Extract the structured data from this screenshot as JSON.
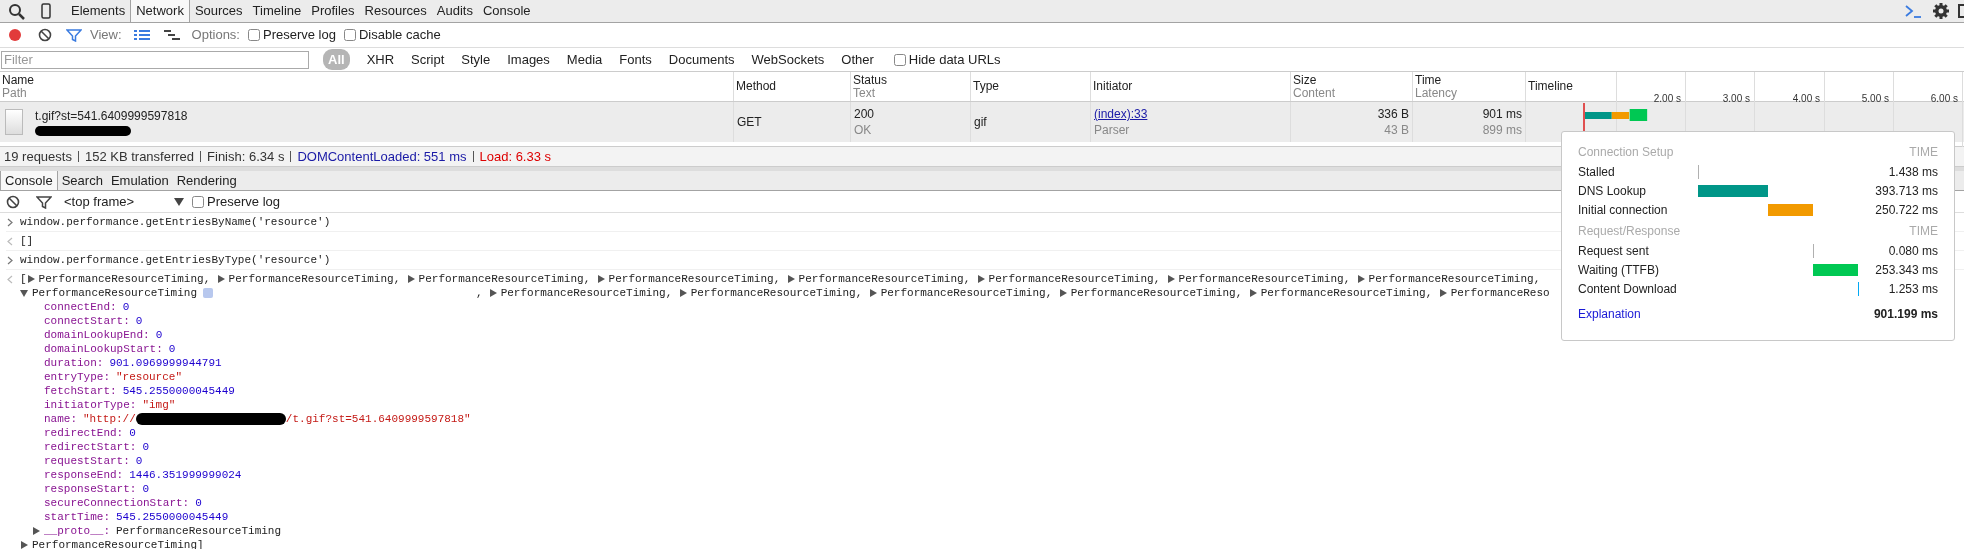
{
  "main_tabs": [
    {
      "label": "Elements",
      "selected": false
    },
    {
      "label": "Network",
      "selected": true
    },
    {
      "label": "Sources",
      "selected": false
    },
    {
      "label": "Timeline",
      "selected": false
    },
    {
      "label": "Profiles",
      "selected": false
    },
    {
      "label": "Resources",
      "selected": false
    },
    {
      "label": "Audits",
      "selected": false
    },
    {
      "label": "Console",
      "selected": false
    }
  ],
  "network_toolbar": {
    "recording": true,
    "view_label": "View:",
    "options_label": "Options:",
    "checkboxes": [
      {
        "label": "Preserve log",
        "checked": false
      },
      {
        "label": "Disable cache",
        "checked": false
      }
    ]
  },
  "filter_bar": {
    "placeholder": "Filter",
    "types": [
      {
        "label": "All",
        "selected": true
      },
      {
        "label": "XHR",
        "selected": false
      },
      {
        "label": "Script",
        "selected": false
      },
      {
        "label": "Style",
        "selected": false
      },
      {
        "label": "Images",
        "selected": false
      },
      {
        "label": "Media",
        "selected": false
      },
      {
        "label": "Fonts",
        "selected": false
      },
      {
        "label": "Documents",
        "selected": false
      },
      {
        "label": "WebSockets",
        "selected": false
      },
      {
        "label": "Other",
        "selected": false
      }
    ],
    "hide_data_urls": {
      "label": "Hide data URLs",
      "checked": false
    }
  },
  "table": {
    "columns": [
      {
        "label": "Name",
        "sublabel": "Path"
      },
      {
        "label": "Method"
      },
      {
        "label": "Status",
        "sublabel": "Text"
      },
      {
        "label": "Type"
      },
      {
        "label": "Initiator"
      },
      {
        "label": "Size",
        "sublabel": "Content"
      },
      {
        "label": "Time",
        "sublabel": "Latency"
      },
      {
        "label": "Timeline"
      }
    ],
    "timeline_ticks": [
      "2.00 s",
      "3.00 s",
      "4.00 s",
      "5.00 s",
      "6.00 s"
    ],
    "rows": [
      {
        "name": "t.gif?st=541.6409999597818",
        "method": "GET",
        "status": "200",
        "status_text": "OK",
        "type": "gif",
        "initiator": "(index):33",
        "initiator_type": "Parser",
        "size": "336 B",
        "content": "43 B",
        "time": "901 ms",
        "latency": "899 ms",
        "selected": true
      }
    ]
  },
  "summary": [
    {
      "text": "19 requests",
      "kind": "plain"
    },
    {
      "text": "152 KB transferred",
      "kind": "plain"
    },
    {
      "text": "Finish: 6.34 s",
      "kind": "plain"
    },
    {
      "text": "DOMContentLoaded: 551 ms",
      "kind": "dom"
    },
    {
      "text": "Load: 6.33 s",
      "kind": "load"
    }
  ],
  "drawer_tabs": [
    {
      "label": "Console",
      "selected": true
    },
    {
      "label": "Search",
      "selected": false
    },
    {
      "label": "Emulation",
      "selected": false
    },
    {
      "label": "Rendering",
      "selected": false
    }
  ],
  "console_toolbar": {
    "frame": "<top frame>",
    "preserve_log": {
      "label": "Preserve log",
      "checked": false
    }
  },
  "console": [
    {
      "kind": "input",
      "text": "window.performance.getEntriesByName('resource')"
    },
    {
      "kind": "output",
      "text": "[]"
    },
    {
      "kind": "input",
      "text": "window.performance.getEntriesByType('resource')"
    },
    {
      "kind": "array",
      "open": "[",
      "first_row": [
        "PerformanceResourceTiming,",
        "PerformanceResourceTiming,",
        "PerformanceResourceTiming,",
        "PerformanceResourceTiming,",
        "PerformanceResourceTiming,",
        "PerformanceResourceTiming,",
        "PerformanceResourceTiming,",
        "PerformanceResourceTiming,"
      ],
      "expanded": {
        "label": "PerformanceResourceTiming",
        "expanded": true,
        "properties": [
          {
            "key": "connectEnd:",
            "value": "0",
            "kind": "number"
          },
          {
            "key": "connectStart:",
            "value": "0",
            "kind": "number"
          },
          {
            "key": "domainLookupEnd:",
            "value": "0",
            "kind": "number"
          },
          {
            "key": "domainLookupStart:",
            "value": "0",
            "kind": "number"
          },
          {
            "key": "duration:",
            "value": "901.0969999944791",
            "kind": "number"
          },
          {
            "key": "entryType:",
            "value": "\"resource\"",
            "kind": "string"
          },
          {
            "key": "fetchStart:",
            "value": "545.2550000045449",
            "kind": "number"
          },
          {
            "key": "initiatorType:",
            "value": "\"img\"",
            "kind": "string"
          },
          {
            "key": "name:",
            "value": "\"http://",
            "value_tail": "/t.gif?st=541.6409999597818\"",
            "kind": "string"
          },
          {
            "key": "redirectEnd:",
            "value": "0",
            "kind": "number"
          },
          {
            "key": "redirectStart:",
            "value": "0",
            "kind": "number"
          },
          {
            "key": "requestStart:",
            "value": "0",
            "kind": "number"
          },
          {
            "key": "responseEnd:",
            "value": "1446.351999999024",
            "kind": "number"
          },
          {
            "key": "responseStart:",
            "value": "0",
            "kind": "number"
          },
          {
            "key": "secureConnectionStart:",
            "value": "0",
            "kind": "number"
          },
          {
            "key": "startTime:",
            "value": "545.2550000045449",
            "kind": "number"
          }
        ],
        "proto": {
          "key": "__proto__:",
          "value": "PerformanceResourceTiming",
          "expanded": false
        }
      },
      "separator": ",",
      "second_row": [
        "PerformanceResourceTiming,",
        "PerformanceResourceTiming,",
        "PerformanceResourceTiming,",
        "PerformanceResourceTiming,",
        "PerformanceResourceTiming,",
        "PerformanceReso"
      ],
      "last": {
        "label": "PerformanceResourceTiming]",
        "expanded": false
      }
    }
  ],
  "timing_popup": {
    "sections": [
      {
        "title": "Connection Setup",
        "time_header": "TIME",
        "rows": [
          {
            "label": "Stalled",
            "time": "1.438 ms",
            "color": "#b0b0b0"
          },
          {
            "label": "DNS Lookup",
            "time": "393.713 ms",
            "color": "#009688"
          },
          {
            "label": "Initial connection",
            "time": "250.722 ms",
            "color": "#f29a00"
          }
        ]
      },
      {
        "title": "Request/Response",
        "time_header": "TIME",
        "rows": [
          {
            "label": "Request sent",
            "time": "0.080 ms",
            "color": "#b0b0b0"
          },
          {
            "label": "Waiting (TTFB)",
            "time": "253.343 ms",
            "color": "#00c853"
          },
          {
            "label": "Content Download",
            "time": "1.253 ms",
            "color": "#03a9f4"
          }
        ]
      }
    ],
    "link": "Explanation",
    "total": "901.199 ms"
  }
}
